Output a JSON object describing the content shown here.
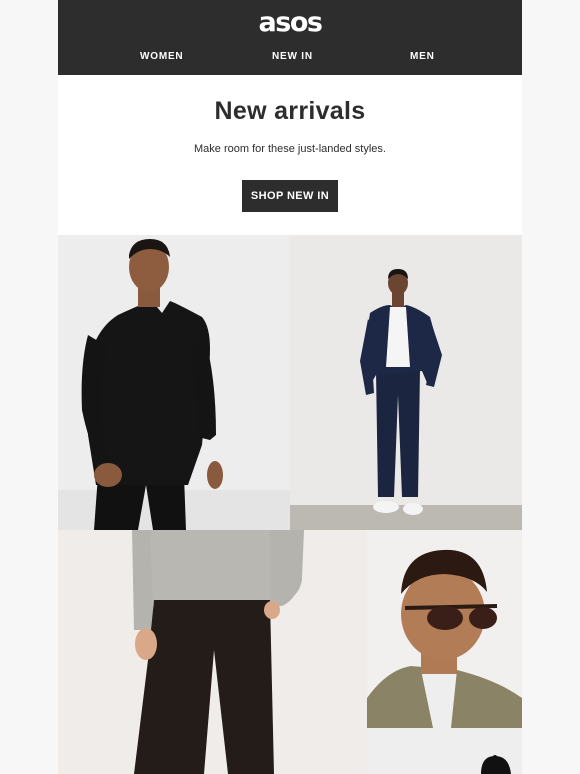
{
  "header": {
    "logo": "asos",
    "nav": [
      {
        "label": "WOMEN"
      },
      {
        "label": "NEW IN"
      },
      {
        "label": "MEN"
      }
    ]
  },
  "hero": {
    "title": "New arrivals",
    "subtitle": "Make room for these just-landed styles.",
    "cta_label": "SHOP NEW IN"
  },
  "colors": {
    "header_bg": "#2d2d2d",
    "text": "#2d2d2d",
    "page_bg": "#f7f7f7",
    "email_bg": "#ffffff"
  },
  "images": [
    {
      "name": "black-shirt-model-photo"
    },
    {
      "name": "navy-suit-model-photo"
    },
    {
      "name": "grey-jumper-trousers-photo"
    },
    {
      "name": "sunglasses-model-photo"
    },
    {
      "name": "cap-product-photo"
    }
  ]
}
